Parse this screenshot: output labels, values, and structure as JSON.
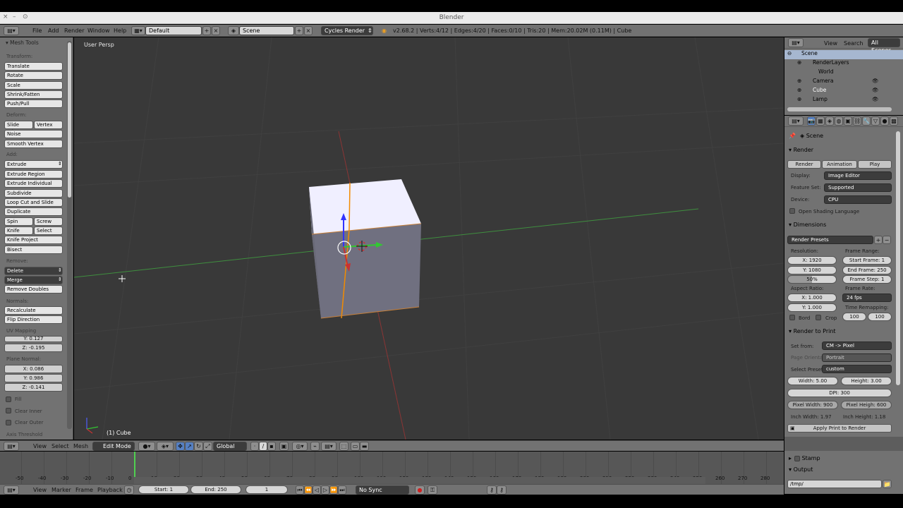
{
  "window": {
    "title": "Blender",
    "controls": [
      "×",
      "–",
      "⊙"
    ]
  },
  "infobar": {
    "menus": [
      "File",
      "Add",
      "Render",
      "Window",
      "Help"
    ],
    "layout": "Default",
    "scene": "Scene",
    "engine": "Cycles Render",
    "stats": "v2.68.2 | Verts:4/12 | Edges:4/20 | Faces:0/10 | Tris:20 | Mem:20.02M (0.11M) | Cube"
  },
  "toolshelf": {
    "title": "Mesh Tools",
    "transform": {
      "label": "Transform:",
      "buttons": [
        "Translate",
        "Rotate",
        "Scale",
        "Shrink/Fatten",
        "Push/Pull"
      ]
    },
    "deform": {
      "label": "Deform:",
      "slide_edge": "Slide Edge",
      "vertex": "Vertex",
      "noise": "Noise",
      "smooth_vertex": "Smooth Vertex"
    },
    "add": {
      "label": "Add:",
      "extrude": "Extrude",
      "extrude_region": "Extrude Region",
      "extrude_individual": "Extrude Individual",
      "subdivide": "Subdivide",
      "loop_cut": "Loop Cut and Slide",
      "duplicate": "Duplicate",
      "spin": "Spin",
      "screw": "Screw",
      "knife": "Knife",
      "select": "Select",
      "knife_project": "Knife Project",
      "bisect": "Bisect"
    },
    "remove": {
      "label": "Remove:",
      "delete": "Delete",
      "merge": "Merge",
      "remove_doubles": "Remove Doubles"
    },
    "normals": {
      "label": "Normals:",
      "recalculate": "Recalculate",
      "flip_direction": "Flip Direction"
    },
    "uv_mapping": {
      "label": "UV Mapping",
      "y": "Y: 0.127",
      "z": "Z: -0.195"
    },
    "plane_normal": {
      "label": "Plane Normal:",
      "x": "X: 0.086",
      "y": "Y: 0.986",
      "z": "Z: -0.141"
    },
    "fill": "Fill",
    "clear_inner": "Clear Inner",
    "clear_outer": "Clear Outer",
    "axis_threshold": "Axis Threshold"
  },
  "viewport": {
    "view_name": "User Persp",
    "object_label": "(1) Cube"
  },
  "viewport_header": {
    "menus": [
      "View",
      "Select",
      "Mesh"
    ],
    "mode": "Edit Mode",
    "orientation": "Global"
  },
  "timeline": {
    "ticks": [
      "-50",
      "-40",
      "-30",
      "-20",
      "-10",
      "0",
      "10",
      "20",
      "30",
      "40",
      "50",
      "60",
      "70",
      "80",
      "90",
      "100",
      "110",
      "120",
      "130",
      "140",
      "150",
      "160",
      "170",
      "180",
      "190",
      "200",
      "210",
      "220",
      "230",
      "240",
      "250",
      "260",
      "270",
      "280"
    ],
    "menus": [
      "View",
      "Marker",
      "Frame",
      "Playback"
    ],
    "start": "Start: 1",
    "end": "End: 250",
    "current": "1",
    "sync": "No Sync"
  },
  "outliner": {
    "menus": [
      "View",
      "Search"
    ],
    "filter": "All Scenes",
    "items": [
      "Scene",
      "RenderLayers",
      "World",
      "Camera",
      "Cube",
      "Lamp"
    ]
  },
  "properties": {
    "breadcrumb": "Scene",
    "render_panel": {
      "title": "Render",
      "render_btn": "Render",
      "animation_btn": "Animation",
      "play_btn": "Play",
      "display_label": "Display:",
      "display_value": "Image Editor",
      "feature_label": "Feature Set:",
      "feature_value": "Supported",
      "device_label": "Device:",
      "device_value": "CPU",
      "osl": "Open Shading Language"
    },
    "dimensions_panel": {
      "title": "Dimensions",
      "presets": "Render Presets",
      "resolution_label": "Resolution:",
      "res_x": "X: 1920",
      "res_y": "Y: 1080",
      "res_pct": "50%",
      "frame_range_label": "Frame Range:",
      "start_frame": "Start Frame: 1",
      "end_frame": "End Frame: 250",
      "frame_step": "Frame Step: 1",
      "aspect_label": "Aspect Ratio:",
      "asp_x": "X: 1.000",
      "asp_y": "Y: 1.000",
      "frame_rate_label": "Frame Rate:",
      "fps": "24 fps",
      "remap_label": "Time Remapping:",
      "remap_old": "100",
      "remap_new": "100",
      "bord": "Bord",
      "crop": "Crop"
    },
    "print_panel": {
      "title": "Render to Print",
      "set_from_label": "Set from:",
      "set_from_value": "CM -> Pixel",
      "orient_label": "Page Orienta",
      "orient_value": "Portrait",
      "preset_label": "Select Preset",
      "preset_value": "custom",
      "width": "Width: 5.00",
      "height": "Height: 3.00",
      "dpi": "DPI: 300",
      "px_width": "Pixel Width: 900",
      "px_height": "Pixel Heigh: 600",
      "inch_width": "Inch Width: 1.97",
      "inch_height": "Inch Height: 1.18",
      "apply": "Apply Print to Render"
    },
    "stamp": "Stamp",
    "output": "Output",
    "output_path": "/tmp/"
  },
  "colors": {
    "viewport_bg": "#393939",
    "panel_bg": "#727272",
    "x_axis": "#c83232",
    "y_axis": "#32c832",
    "z_axis": "#3232ff",
    "selection": "#f28b00"
  }
}
